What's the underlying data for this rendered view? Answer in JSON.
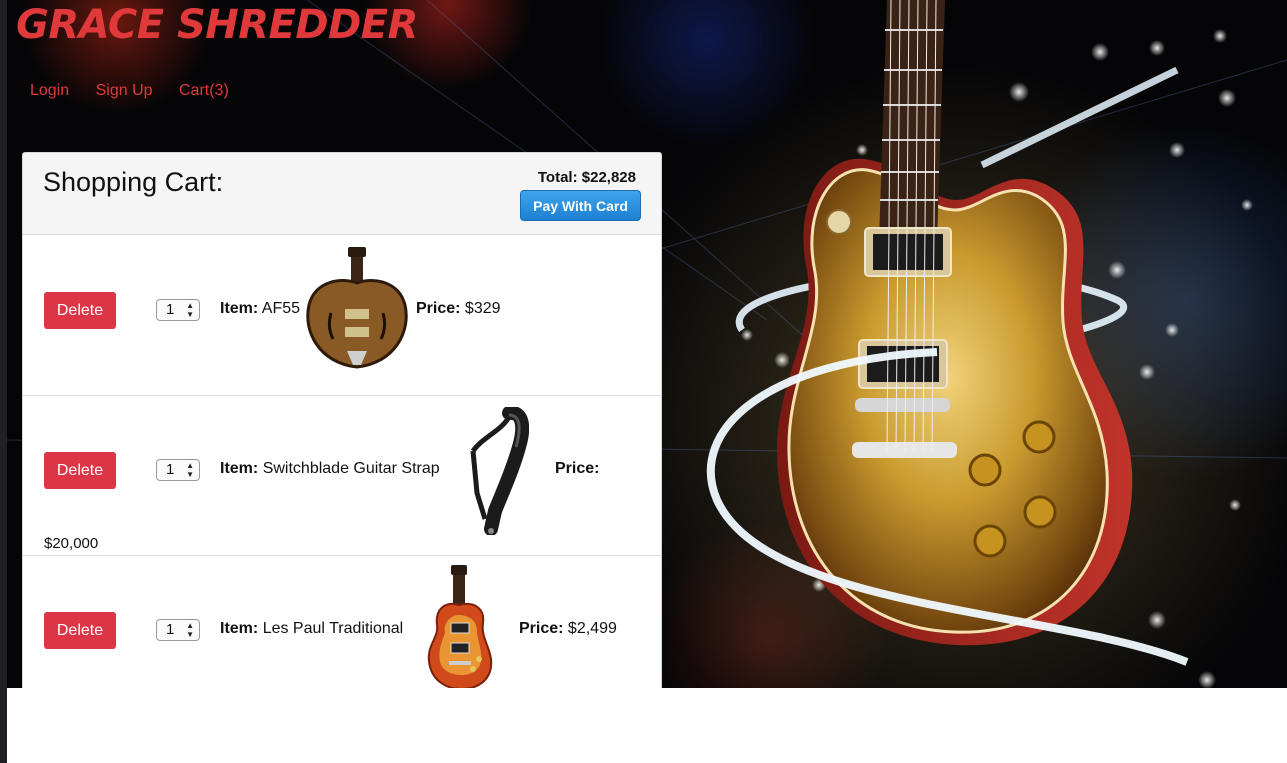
{
  "brand": {
    "logo": "Grace Shredder",
    "color": "#e0393b"
  },
  "nav": [
    {
      "label": "Login"
    },
    {
      "label": "Sign Up"
    },
    {
      "label": "Cart(3)"
    }
  ],
  "cart": {
    "title": "Shopping Cart:",
    "total_label": "Total:",
    "total_value": "$22,828",
    "pay_button": "Pay With Card",
    "item_label": "Item:",
    "price_label": "Price:",
    "delete_label": "Delete",
    "items": [
      {
        "qty": "1",
        "name": "AF55",
        "price": "$329",
        "image": "hollowbody-guitar"
      },
      {
        "qty": "1",
        "name": "Switchblade Guitar Strap",
        "price": "$20,000",
        "image": "guitar-strap"
      },
      {
        "qty": "1",
        "name": "Les Paul Traditional",
        "price": "$2,499",
        "image": "les-paul-guitar"
      }
    ]
  },
  "colors": {
    "delete": "#dc3545",
    "pay": "#2b8fe0",
    "background": "#050507"
  }
}
